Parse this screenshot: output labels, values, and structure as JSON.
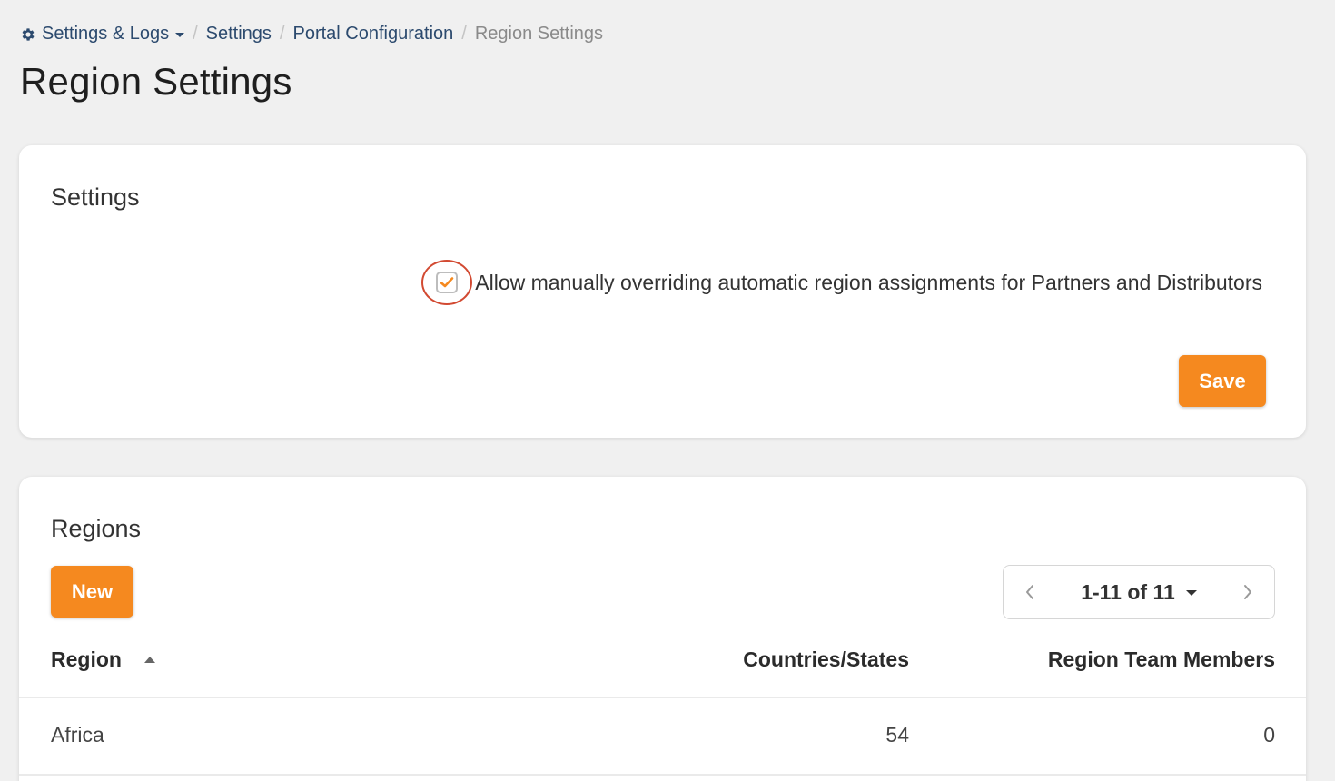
{
  "breadcrumb": {
    "root_label": "Settings & Logs",
    "items": [
      "Settings",
      "Portal Configuration"
    ],
    "current": "Region Settings",
    "separator": "/"
  },
  "page": {
    "title": "Region Settings"
  },
  "settings_card": {
    "title": "Settings",
    "override_checkbox": {
      "label": "Allow manually overriding automatic region assignments for Partners and Distributors",
      "checked": true
    },
    "save_label": "Save"
  },
  "regions_card": {
    "title": "Regions",
    "new_label": "New",
    "pagination": {
      "label": "1-11 of 11"
    },
    "columns": [
      "Region",
      "Countries/States",
      "Region Team Members"
    ],
    "rows": [
      {
        "region": "Africa",
        "countries": "54",
        "members": "0"
      }
    ]
  },
  "colors": {
    "accent": "#f5891f",
    "highlight_ring": "#d24a32",
    "link": "#2c4a6e",
    "background": "#f0f0f0"
  },
  "icons": [
    "gear-icon",
    "caret-down-icon",
    "check-icon",
    "sort-asc-icon",
    "chevron-left-icon",
    "chevron-right-icon"
  ]
}
